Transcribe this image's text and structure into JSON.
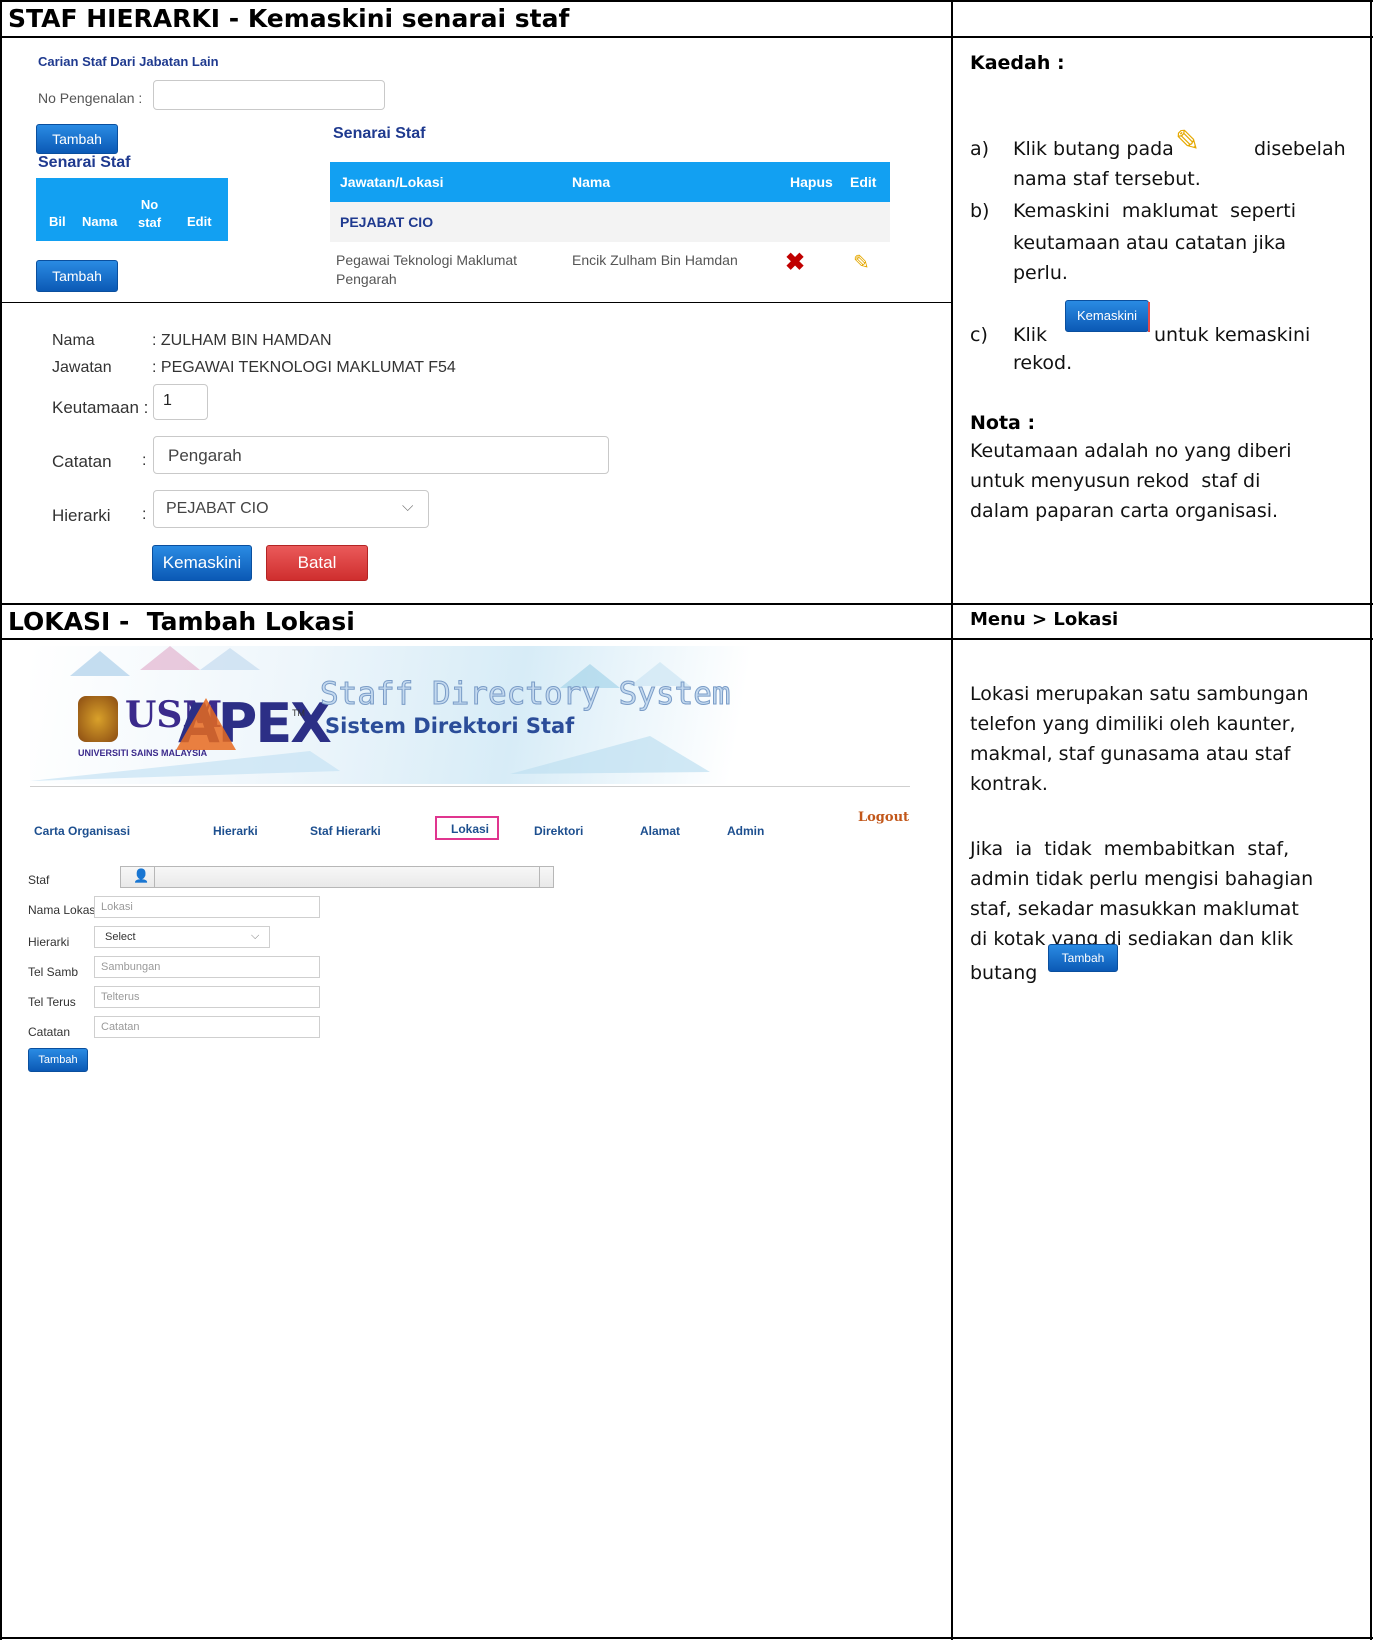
{
  "section1": {
    "title": "STAF HIERARKI - Kemaskini senarai staf",
    "search": {
      "heading": "Carian Staf Dari Jabatan Lain",
      "id_label": "No Pengenalan :",
      "add_label": "Tambah"
    },
    "left_list": {
      "title": "Senarai Staf",
      "columns": [
        "Bil",
        "Nama",
        "No\nstaf",
        "Edit"
      ],
      "add_label": "Tambah"
    },
    "right_list": {
      "title": "Senarai Staf",
      "columns": [
        "Jawatan/Lokasi",
        "Nama",
        "Hapus",
        "Edit"
      ],
      "group": "PEJABAT CIO",
      "row": {
        "position_line1": "Pegawai Teknologi Maklumat",
        "position_line2": "Pengarah",
        "name": "Encik Zulham Bin Hamdan"
      }
    },
    "form": {
      "nama_label": "Nama",
      "nama_value": ": ZULHAM BIN HAMDAN",
      "jawatan_label": "Jawatan",
      "jawatan_value": ": PEGAWAI TEKNOLOGI MAKLUMAT F54",
      "keutamaan_label": "Keutamaan :",
      "keutamaan_value": "1",
      "catatan_label": "Catatan",
      "catatan_value": "Pengarah",
      "hierarki_label": "Hierarki",
      "hierarki_value": "PEJABAT CIO",
      "colon": ":",
      "update_label": "Kemaskini",
      "cancel_label": "Batal"
    }
  },
  "instructions": {
    "kaedah_title": "Kaedah :",
    "step_a_letter": "a)",
    "step_a_pre": "Klik butang pada",
    "step_a_post": "disebelah",
    "step_a_line2": "nama staf tersebut.",
    "step_b_letter": "b)",
    "step_b_line1": "Kemaskini  maklumat  seperti",
    "step_b_line2": "keutamaan atau catatan jika",
    "step_b_line3": "perlu.",
    "step_c_letter": "c)",
    "step_c_pre": "Klik",
    "step_c_button": "Kemaskini",
    "step_c_post": "untuk kemaskini",
    "step_c_line2": "rekod.",
    "nota_title": "Nota :",
    "nota_line1": "Keutamaan adalah no yang diberi",
    "nota_line2": "untuk menyusun rekod  staf di",
    "nota_line3": "dalam paparan carta organisasi."
  },
  "section2": {
    "title": "LOKASI -  Tambah Lokasi",
    "menu_path": "Menu > Lokasi",
    "banner": {
      "usm_text": "USM",
      "usm_sub": "UNIVERSITI SAINS MALAYSIA",
      "apex_text": "APEX",
      "tm": "TM",
      "title_en": "Staff Directory System",
      "title_ms": "Sistem Direktori Staf"
    },
    "nav": [
      "Carta Organisasi",
      "Hierarki",
      "Staf Hierarki",
      "Lokasi",
      "Direktori",
      "Alamat",
      "Admin"
    ],
    "logout": "Logout",
    "fields": {
      "staf_label": "Staf",
      "nama_lokasi_label": "Nama Lokasi",
      "nama_lokasi_ph": "Lokasi",
      "hierarki_label": "Hierarki",
      "hierarki_value": "Select",
      "tel_samb_label": "Tel Samb",
      "tel_samb_ph": "Sambungan",
      "tel_terus_label": "Tel Terus",
      "tel_terus_ph": "Telterus",
      "catatan_label": "Catatan",
      "catatan_ph": "Catatan",
      "add_label": "Tambah"
    },
    "desc": {
      "line1": "Lokasi merupakan satu sambungan",
      "line2": "telefon yang dimiliki oleh kaunter,",
      "line3": "makmal, staf gunasama atau staf",
      "line4": "kontrak.",
      "line5": "Jika  ia  tidak  membabitkan  staf,",
      "line6": "admin tidak perlu mengisi bahagian",
      "line7": "staf, sekadar masukkan maklumat",
      "line8": "di kotak yang di sediakan dan klik",
      "line9_pre": "butang",
      "line9_button": "Tambah"
    }
  },
  "colors": {
    "table_head": "#12a0f2",
    "button_blue": "#0b59b5",
    "button_red": "#cf2e2e",
    "nav_highlight": "#e0358f"
  }
}
